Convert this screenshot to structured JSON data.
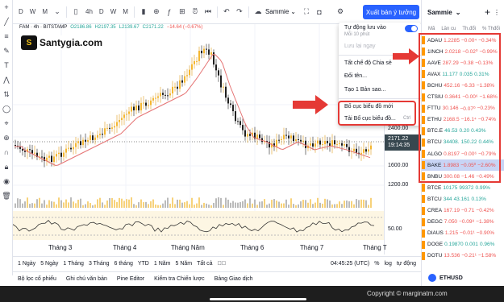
{
  "toolbar": {
    "timeframes": [
      "D",
      "W",
      "M"
    ],
    "interval": "4h",
    "interval_tabs": [
      "D",
      "W",
      "M"
    ],
    "layout_name": "Sammie",
    "publish_label": "Xuất bản ý tưởng"
  },
  "legend": {
    "symbol": "FAM · 4h · BITSTAMP",
    "open": "O2186.86",
    "high": "H2197.35",
    "low": "L2139.67",
    "close": "C2171.22",
    "change": "−14.64 (−0.67%)"
  },
  "watermark": {
    "brand": "Santygia.com",
    "logo_letter": "S"
  },
  "price_scale": {
    "labels": [
      "2400.00",
      "2171.22",
      "19:14:35",
      "1600.00",
      "1200.00",
      "50.00"
    ],
    "last_price": "2171.22",
    "countdown": "19:14:35"
  },
  "time_axis": {
    "labels": [
      "Tháng 3",
      "Tháng 4",
      "Tháng Năm",
      "Tháng 6",
      "Tháng 7",
      "Tháng T"
    ]
  },
  "ranges": {
    "items": [
      "1 Ngày",
      "5 Ngày",
      "1 Tháng",
      "3 Tháng",
      "6 tháng",
      "YTD",
      "1 Năm",
      "5 Năm",
      "Tất cả"
    ],
    "time": "04:45:25 (UTC)",
    "percent": "%",
    "log": "log",
    "auto": "tự động"
  },
  "bottom_tabs": [
    "Bộ lọc cổ phiếu",
    "Ghi chú văn bản",
    "Pine Editor",
    "Kiểm tra Chiến lược",
    "Bảng Giao dịch"
  ],
  "menu": {
    "autosave": "Tự động lưu vào",
    "autosave_sub": "Mỗi 10 phút",
    "save_now": "Lưu lại ngay",
    "share_all": "Tất chế độ Chia sẻ",
    "rename": "Đổi tên...",
    "create_copy": "Tạo 1 Bản sao...",
    "new_layout": "Bố cục biểu đồ mới",
    "load_layout": "Tải Bố cục biểu đồ...",
    "load_shortcut": "Ctrl"
  },
  "watchlist": {
    "title": "Sammie",
    "columns": [
      "Mã",
      "Lần cu",
      "Th.đổi",
      "% Thđổi"
    ],
    "rows": [
      {
        "symbol": "ADAU",
        "price": "1.2285",
        "chg": "−0.00⁴",
        "pct": "−0.34%",
        "dir": "neg"
      },
      {
        "symbol": "1INCH",
        "price": "2.0218",
        "chg": "−0.02⁰",
        "pct": "−0.99%",
        "dir": "neg"
      },
      {
        "symbol": "AAVE",
        "price": "287.29",
        "chg": "−0.38",
        "pct": "−0.13%",
        "dir": "neg"
      },
      {
        "symbol": "AVAX",
        "price": "11.177",
        "chg": "0.035",
        "pct": "0.31%",
        "dir": "pos"
      },
      {
        "symbol": "BCHU",
        "price": "452.16",
        "chg": "−6.33",
        "pct": "−1.38%",
        "dir": "neg"
      },
      {
        "symbol": "CTSIU",
        "price": "0.3641",
        "chg": "−0.00⁶",
        "pct": "−1.68%",
        "dir": "neg"
      },
      {
        "symbol": "FTTU",
        "price": "30.146",
        "chg": "−0.07⁰",
        "pct": "−0.23%",
        "dir": "neg"
      },
      {
        "symbol": "ETHU",
        "price": "2168.5",
        "chg": "−16.1⁴",
        "pct": "−0.74%",
        "dir": "neg"
      },
      {
        "symbol": "BTC.E",
        "price": "46.53",
        "chg": "0.20",
        "pct": "0.43%",
        "dir": "pos"
      },
      {
        "symbol": "BTCU",
        "price": "34408.",
        "chg": "150.22",
        "pct": "0.44%",
        "dir": "pos"
      },
      {
        "symbol": "ALGO",
        "price": "0.8197",
        "chg": "−0.00⁶",
        "pct": "−0.79%",
        "dir": "neg"
      },
      {
        "symbol": "BAKE",
        "price": "1.8983",
        "chg": "−0.05⁰",
        "pct": "−2.60%",
        "dir": "neg"
      },
      {
        "symbol": "BNBU",
        "price": "300.08",
        "chg": "−1.46",
        "pct": "−0.49%",
        "dir": "neg"
      },
      {
        "symbol": "BTCE",
        "price": "10175",
        "chg": "99372",
        "pct": "0.99%",
        "dir": "pos"
      },
      {
        "symbol": "BTCU",
        "price": "344",
        "chg": "43.161",
        "pct": "0.13%",
        "dir": "pos"
      },
      {
        "symbol": "CREA",
        "price": "167.19",
        "chg": "−0.71",
        "pct": "−0.42%",
        "dir": "neg"
      },
      {
        "symbol": "DEGC",
        "price": "7.050",
        "chg": "−0.09⁸",
        "pct": "−1.38%",
        "dir": "neg"
      },
      {
        "symbol": "DIAUS",
        "price": "1.215",
        "chg": "−0.01¹",
        "pct": "−0.90%",
        "dir": "neg"
      },
      {
        "symbol": "DOGE",
        "price": "0.19870",
        "chg": "0.001",
        "pct": "0.96%",
        "dir": "pos"
      },
      {
        "symbol": "DOTU",
        "price": "13.536",
        "chg": "−0.21¹",
        "pct": "−1.58%",
        "dir": "neg"
      }
    ],
    "footer_symbol": "ETHUSD"
  },
  "copyright": "Copyright © marginatm.com",
  "colors": {
    "accent": "#2962ff",
    "up": "#f5b731",
    "down": "#1f1f1f",
    "ma": "#e57373",
    "highlight": "#e53935"
  }
}
